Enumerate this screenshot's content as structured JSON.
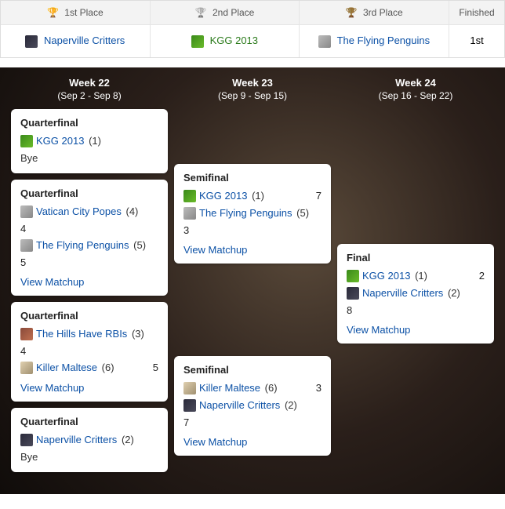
{
  "podium": {
    "places": [
      {
        "label": "1st Place",
        "trophyColor": "#d4a017",
        "team": "Naperville Critters",
        "avatar": "av-dark"
      },
      {
        "label": "2nd Place",
        "trophyColor": "#b8b8b8",
        "team": "KGG 2013",
        "avatar": "av-green"
      },
      {
        "label": "3rd Place",
        "trophyColor": "#6b3e1a",
        "team": "The Flying Penguins",
        "avatar": "av-grey"
      }
    ],
    "finishedLabel": "Finished",
    "finishedValue": "1st"
  },
  "weeks": [
    {
      "title": "Week 22",
      "range": "(Sep 2 - Sep 8)"
    },
    {
      "title": "Week 23",
      "range": "(Sep 9 - Sep 15)"
    },
    {
      "title": "Week 24",
      "range": "(Sep 16 - Sep 22)"
    }
  ],
  "labels": {
    "quarterfinal": "Quarterfinal",
    "semifinal": "Semifinal",
    "final": "Final",
    "bye": "Bye",
    "viewMatchup": "View Matchup"
  },
  "qf": [
    {
      "teams": [
        {
          "name": "KGG 2013",
          "seed": "(1)",
          "avatar": "av-green"
        }
      ],
      "bye": true
    },
    {
      "teams": [
        {
          "name": "Vatican City Popes",
          "seed": "(4)",
          "avatar": "av-grey",
          "score": "4"
        },
        {
          "name": "The Flying Penguins",
          "seed": "(5)",
          "avatar": "av-grey",
          "score": "5"
        }
      ]
    },
    {
      "teams": [
        {
          "name": "The Hills Have RBIs",
          "seed": "(3)",
          "avatar": "av-girl",
          "score": "4"
        },
        {
          "name": "Killer Maltese",
          "seed": "(6)",
          "avatar": "av-cat",
          "score": "5"
        }
      ]
    },
    {
      "teams": [
        {
          "name": "Naperville Critters",
          "seed": "(2)",
          "avatar": "av-dark"
        }
      ],
      "bye": true
    }
  ],
  "sf": [
    {
      "teams": [
        {
          "name": "KGG 2013",
          "seed": "(1)",
          "avatar": "av-green",
          "score": "7"
        },
        {
          "name": "The Flying Penguins",
          "seed": "(5)",
          "avatar": "av-grey",
          "score": "3"
        }
      ]
    },
    {
      "teams": [
        {
          "name": "Killer Maltese",
          "seed": "(6)",
          "avatar": "av-cat",
          "score": "3"
        },
        {
          "name": "Naperville Critters",
          "seed": "(2)",
          "avatar": "av-dark",
          "score": "7"
        }
      ]
    }
  ],
  "final": {
    "teams": [
      {
        "name": "KGG 2013",
        "seed": "(1)",
        "avatar": "av-green",
        "score": "2"
      },
      {
        "name": "Naperville Critters",
        "seed": "(2)",
        "avatar": "av-dark",
        "score": "8"
      }
    ]
  }
}
